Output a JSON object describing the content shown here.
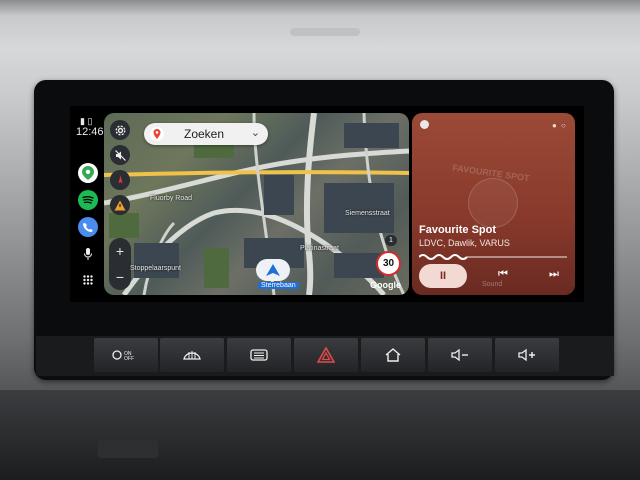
{
  "status": {
    "time": "12:46"
  },
  "rail": {
    "apps": [
      "google-maps-icon",
      "spotify-icon",
      "phone-icon",
      "microphone-icon",
      "app-grid-icon"
    ]
  },
  "map": {
    "search_label": "Zoeken",
    "labels": {
      "road": "Fluorby Road",
      "street1": "Siemensstraat",
      "street2": "Stoppelaarspunt",
      "area": "Platinastraat",
      "nav": "Sterrebaan"
    },
    "speed_limit": "30",
    "badge": "1",
    "brand": "Google",
    "colors": {
      "route": "#f0c24a",
      "road": "#d8dad6"
    }
  },
  "music": {
    "track": "Favourite Spot",
    "artist": "LDVC, Dawlik, VARUS",
    "art_text": "FAVOURITE SPOT",
    "ghost_label": "Sound",
    "pause_symbol": "II",
    "prev_symbol": "⏮",
    "next_symbol": "⏭",
    "progress": 0.2,
    "colors": {
      "card": "#8a3a2b",
      "button": "#f3d9d3"
    }
  },
  "physical_buttons": [
    {
      "label": "ON/OFF"
    },
    {
      "label": "front-defrost-icon"
    },
    {
      "label": "rear-defrost-icon"
    },
    {
      "label": "hazard-icon"
    },
    {
      "label": "home-icon"
    },
    {
      "label": "volume-down-icon"
    },
    {
      "label": "volume-up-icon"
    }
  ]
}
